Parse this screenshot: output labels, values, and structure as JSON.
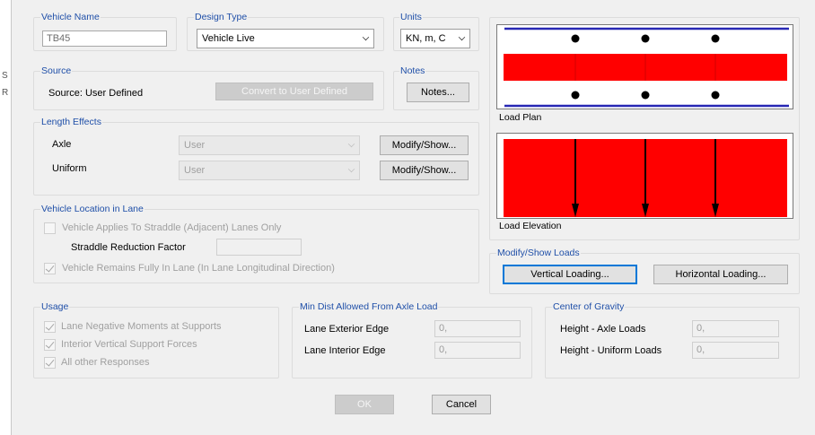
{
  "side_edge": {
    "char1": "S",
    "char2": "R"
  },
  "vehicle_name": {
    "label": "Vehicle Name",
    "value": "TB45"
  },
  "design_type": {
    "label": "Design Type",
    "value": "Vehicle Live"
  },
  "units": {
    "label": "Units",
    "value": "KN, m, C"
  },
  "source": {
    "title": "Source",
    "text": "Source: User Defined",
    "button": "Convert to User Defined"
  },
  "notes": {
    "title": "Notes",
    "button": "Notes..."
  },
  "length_effects": {
    "title": "Length Effects",
    "axle_label": "Axle",
    "axle_value": "User",
    "axle_button": "Modify/Show...",
    "uniform_label": "Uniform",
    "uniform_value": "User",
    "uniform_button": "Modify/Show..."
  },
  "vehicle_location": {
    "title": "Vehicle Location in Lane",
    "straddle_label": "Vehicle Applies To Straddle (Adjacent) Lanes Only",
    "straddle_checked": false,
    "reduction_label": "Straddle Reduction Factor",
    "reduction_value": "",
    "fully_label": "Vehicle Remains Fully In Lane (In Lane Longitudinal Direction)",
    "fully_checked": true
  },
  "usage": {
    "title": "Usage",
    "items": [
      {
        "label": "Lane Negative Moments at Supports",
        "checked": true
      },
      {
        "label": "Interior Vertical Support Forces",
        "checked": true
      },
      {
        "label": "All other Responses",
        "checked": true
      }
    ]
  },
  "min_dist": {
    "title": "Min Dist Allowed From Axle Load",
    "exterior_label": "Lane Exterior Edge",
    "exterior_value": "0,",
    "interior_label": "Lane Interior Edge",
    "interior_value": "0,"
  },
  "center_gravity": {
    "title": "Center of Gravity",
    "axle_label": "Height - Axle Loads",
    "axle_value": "0,",
    "uniform_label": "Height - Uniform Loads",
    "uniform_value": "0,"
  },
  "load_plan": {
    "caption": "Load Plan"
  },
  "load_elevation": {
    "caption": "Load Elevation"
  },
  "modify_show": {
    "title": "Modify/Show Loads",
    "vertical_button": "Vertical Loading...",
    "horizontal_button": "Horizontal Loading..."
  },
  "footer": {
    "ok": "OK",
    "cancel": "Cancel"
  },
  "colors": {
    "load_fill": "#ff0000",
    "lane_line": "#2828b4",
    "group_title": "#1f4fa8"
  }
}
